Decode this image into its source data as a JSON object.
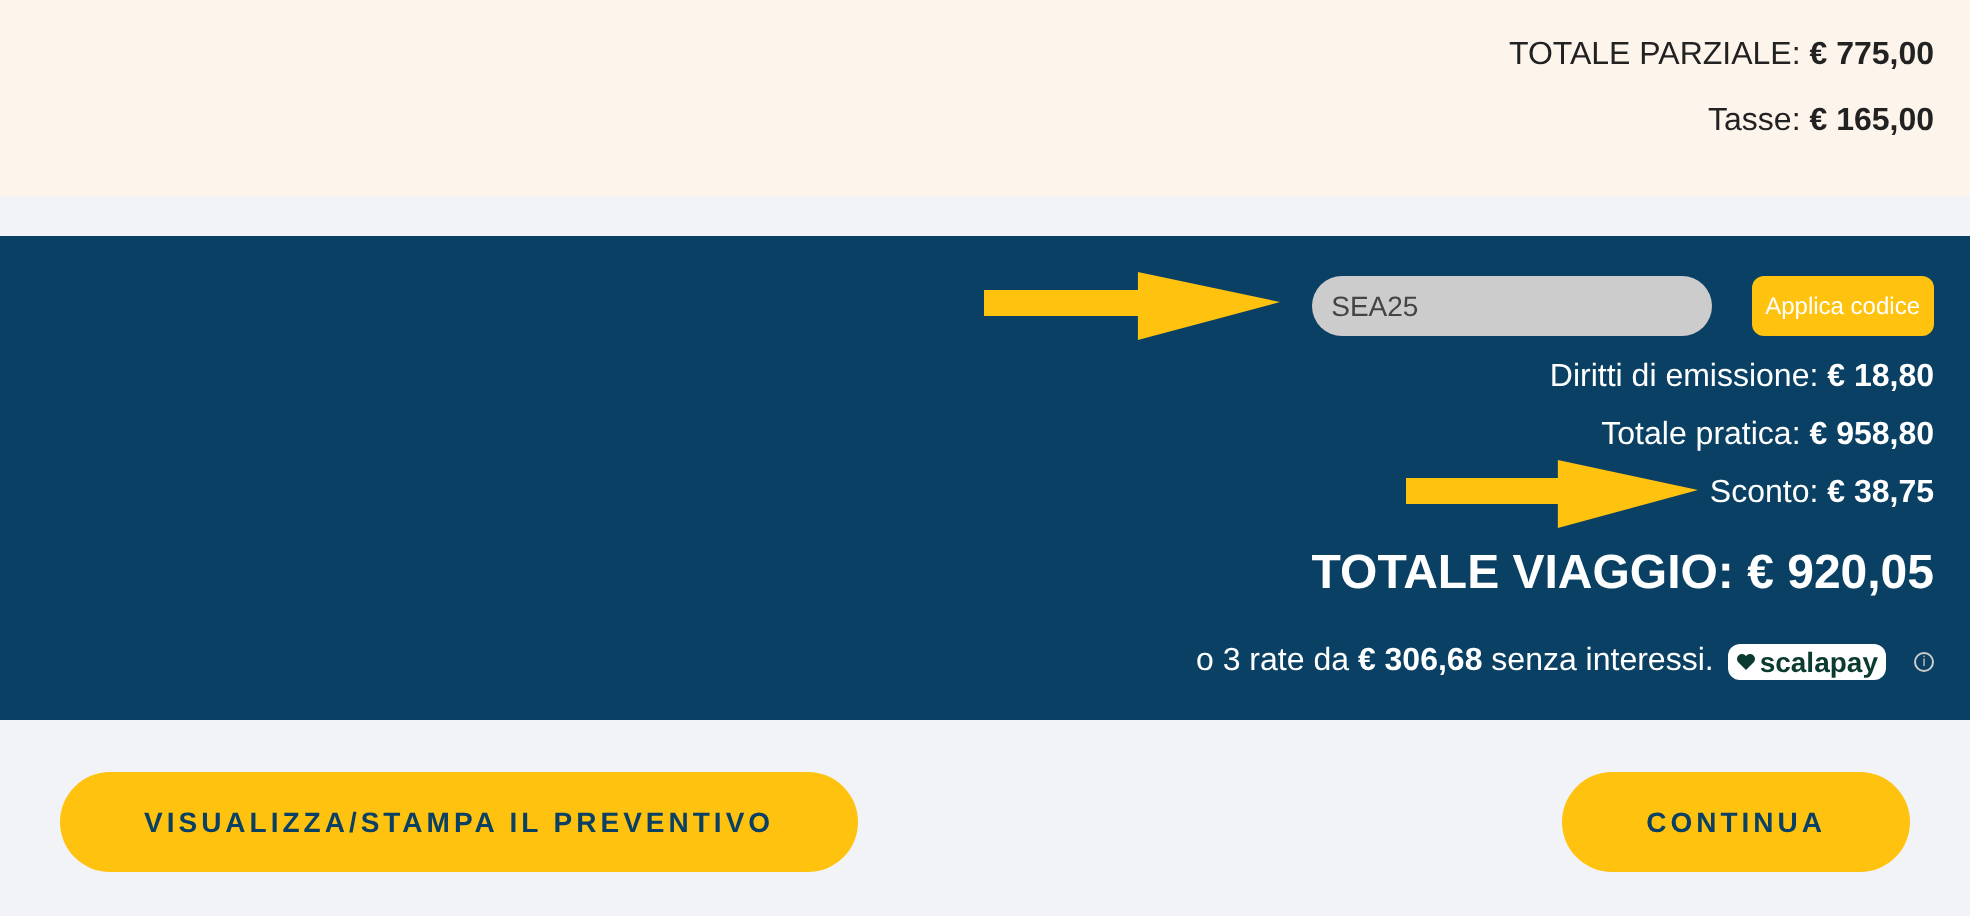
{
  "subtotals": [
    "TOTALE PARZIALE: **€ 775,00**",
    "Tasse: **€ 165,00**"
  ],
  "promo": {
    "value": "SEA25",
    "button": "Applica codice"
  },
  "lines": [
    {
      "text": "Diritti di emissione: **€ 18,80**",
      "highlighted": false
    },
    {
      "text": "Totale pratica: **€ 958,80**",
      "highlighted": false
    },
    {
      "text": "Sconto: **€ 38,75**",
      "highlighted": true
    }
  ],
  "total": "TOTALE VIAGGIO: € 920,05",
  "installments": {
    "text": "o 3 rate da **€ 306,68** senza interessi.",
    "provider": "scalapay",
    "info": "i"
  },
  "buttons": [
    "VISUALIZZA/STAMPA IL PREVENTIVO",
    "CONTINUA"
  ]
}
